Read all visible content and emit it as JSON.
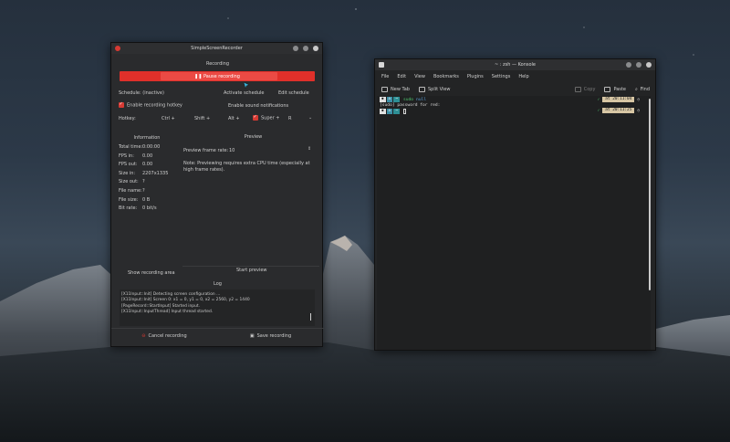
{
  "ssr": {
    "title": "SimpleScreenRecorder",
    "recording_heading": "Recording",
    "pause_label": "❚❚ Pause recording",
    "schedule_status": "Schedule: (inactive)",
    "activate_schedule": "Activate schedule",
    "edit_schedule": "Edit schedule",
    "enable_hotkey": "Enable recording hotkey",
    "enable_sound": "Enable sound notifications",
    "hotkey_label": "Hotkey:",
    "hotkey_ctrl": "Ctrl +",
    "hotkey_shift": "Shift +",
    "hotkey_alt": "Alt +",
    "hotkey_super": "Super +",
    "hotkey_key": "R",
    "info_heading": "Information",
    "info": [
      {
        "label": "Total time:",
        "value": "0:00:00"
      },
      {
        "label": "FPS in:",
        "value": "0.00"
      },
      {
        "label": "FPS out:",
        "value": "0.00"
      },
      {
        "label": "Size in:",
        "value": "2207x1335"
      },
      {
        "label": "Size out:",
        "value": "?"
      },
      {
        "label": "File name:",
        "value": "?"
      },
      {
        "label": "File size:",
        "value": "0 B"
      },
      {
        "label": "Bit rate:",
        "value": "0 bit/s"
      }
    ],
    "preview_heading": "Preview",
    "preview_rate_label": "Preview frame rate:",
    "preview_rate_value": "10",
    "preview_note": "Note: Previewing requires extra CPU time (especially at high frame rates).",
    "show_area": "Show recording area",
    "start_preview": "Start preview",
    "log_heading": "Log",
    "log_lines": [
      "[X11Input::Init] Using X11 shared memory.",
      "[X11Input::Init] Detecting screen configuration ...",
      "[X11Input::Init] Screen 0: x1 = 0, y1 = 0, x2 = 2560, y2 = 1440",
      "[PageRecord::StartInput] Started input.",
      "[X11Input::InputThread] Input thread started."
    ],
    "cancel_recording": "Cancel recording",
    "save_recording": "Save recording"
  },
  "konsole": {
    "title": "~ : zsh — Konsole",
    "menu": [
      "File",
      "Edit",
      "View",
      "Bookmarks",
      "Plugins",
      "Settings",
      "Help"
    ],
    "toolbar": {
      "new_tab": "New Tab",
      "split_view": "Split View",
      "copy": "Copy",
      "paste": "Paste",
      "find": "Find"
    },
    "terminal": {
      "prompt_dir": "~",
      "command_sudo": "sudo",
      "command_arg": "null",
      "output": "[sudo] password for red:",
      "time1": "at 20:11:04",
      "time2": "at 20:11:25"
    }
  },
  "colors": {
    "accent_red": "#e0302a",
    "prompt_blue": "#3c8fa6",
    "ok_green": "#4ec56d",
    "time_bg": "#d7c6a4"
  }
}
